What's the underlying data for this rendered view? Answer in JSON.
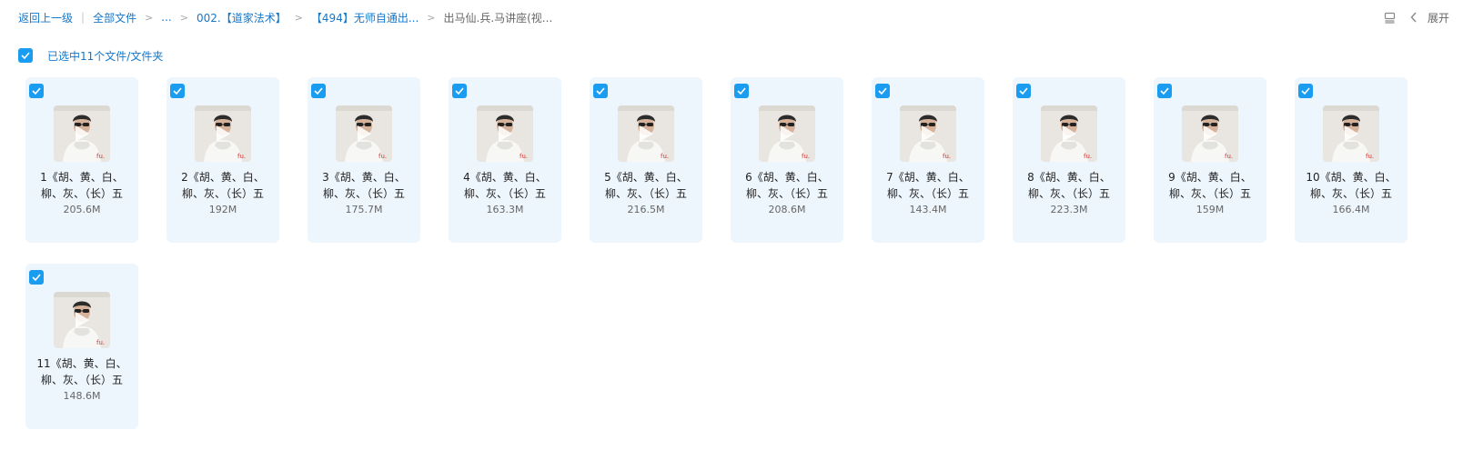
{
  "breadcrumb": {
    "back_label": "返回上一级",
    "all_files_label": "全部文件",
    "ellipsis_label": "...",
    "crumb_1": "002.【道家法术】",
    "crumb_2": "【494】无师自通出...",
    "current": "出马仙.兵.马讲座(视..."
  },
  "toolbar": {
    "list_icon": "list-view-icon",
    "expand_icon": "chevron-left-icon",
    "expand_label": "展开"
  },
  "selection": {
    "label": "已选中11个文件/文件夹",
    "checked": true
  },
  "files": [
    {
      "line1": "1《胡、黄、白、",
      "line2": "柳、灰、（长）五",
      "size": "205.6M",
      "checked": true
    },
    {
      "line1": "2《胡、黄、白、",
      "line2": "柳、灰、（长）五",
      "size": "192M",
      "checked": true
    },
    {
      "line1": "3《胡、黄、白、",
      "line2": "柳、灰、（长）五",
      "size": "175.7M",
      "checked": true
    },
    {
      "line1": "4《胡、黄、白、",
      "line2": "柳、灰、（长）五",
      "size": "163.3M",
      "checked": true
    },
    {
      "line1": "5《胡、黄、白、",
      "line2": "柳、灰、（长）五",
      "size": "216.5M",
      "checked": true
    },
    {
      "line1": "6《胡、黄、白、",
      "line2": "柳、灰、（长）五",
      "size": "208.6M",
      "checked": true
    },
    {
      "line1": "7《胡、黄、白、",
      "line2": "柳、灰、（长）五",
      "size": "143.4M",
      "checked": true
    },
    {
      "line1": "8《胡、黄、白、",
      "line2": "柳、灰、（长）五",
      "size": "223.3M",
      "checked": true
    },
    {
      "line1": "9《胡、黄、白、",
      "line2": "柳、灰、（长）五",
      "size": "159M",
      "checked": true
    },
    {
      "line1": "10《胡、黄、白、",
      "line2": "柳、灰、（长）五",
      "size": "166.4M",
      "checked": true
    },
    {
      "line1": "11《胡、黄、白、",
      "line2": "柳、灰、（长）五",
      "size": "148.6M",
      "checked": true
    }
  ],
  "colors": {
    "accent": "#1a9df0",
    "link": "#1677c9",
    "card_bg": "#eef6fd"
  }
}
